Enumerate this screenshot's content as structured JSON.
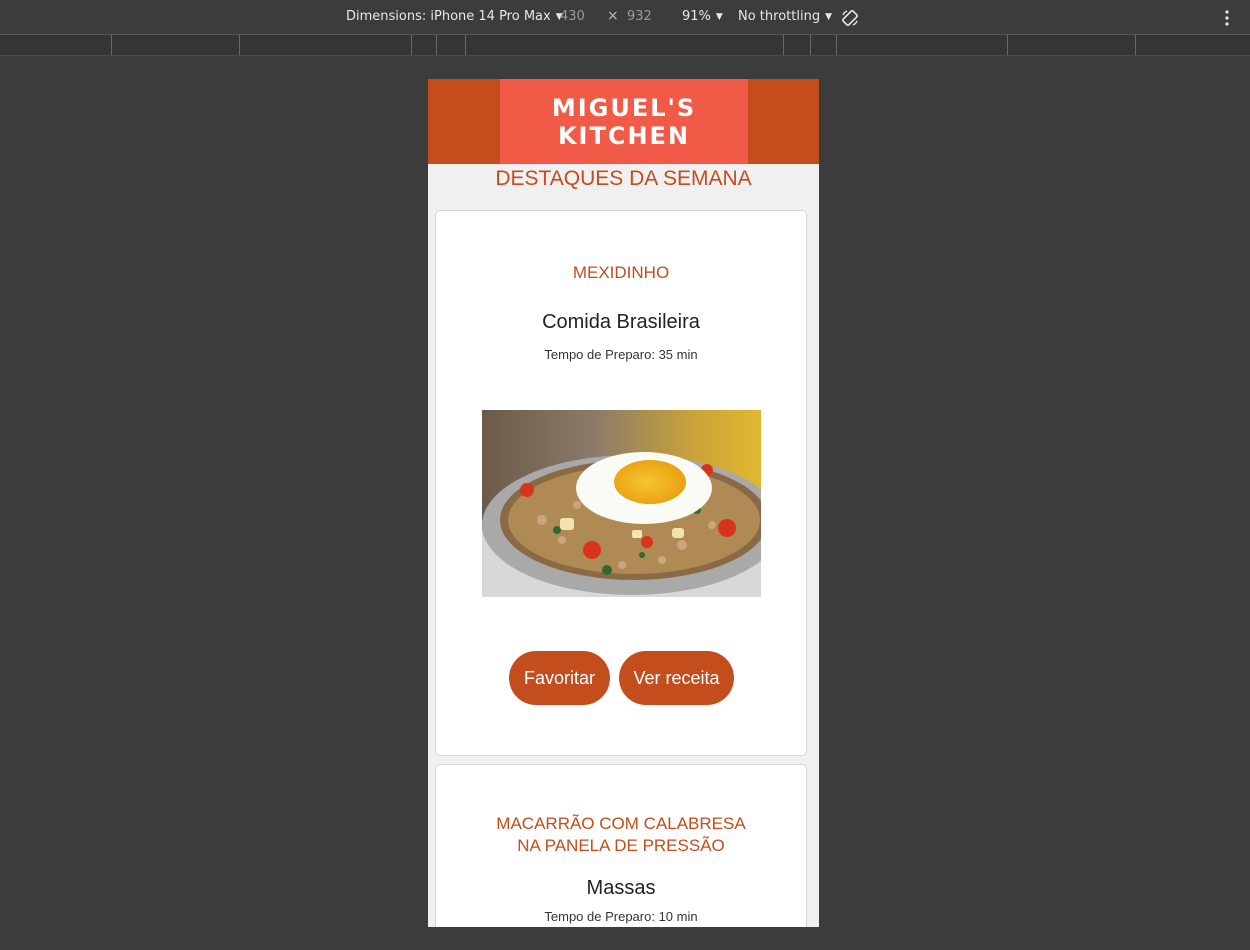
{
  "devtools": {
    "dimensions_label": "Dimensions: iPhone 14 Pro Max",
    "width": "430",
    "times": "×",
    "height": "932",
    "zoom": "91%",
    "throttling": "No throttling"
  },
  "site": {
    "logo_line1": "MIGUEL'S",
    "logo_line2": "KITCHEN",
    "section_title": "DESTAQUES DA SEMANA",
    "colors": {
      "primary": "#c44d1e",
      "logo_bg": "#f05a47"
    }
  },
  "recipes": [
    {
      "title": "MEXIDINHO",
      "category": "Comida Brasileira",
      "prep_time": "Tempo de Preparo: 35 min",
      "favorite_label": "Favoritar",
      "view_label": "Ver receita"
    },
    {
      "title_line1": "MACARRÃO COM CALABRESA",
      "title_line2": "NA PANELA DE PRESSÃO",
      "category": "Massas",
      "prep_time": "Tempo de Preparo: 10 min"
    }
  ]
}
